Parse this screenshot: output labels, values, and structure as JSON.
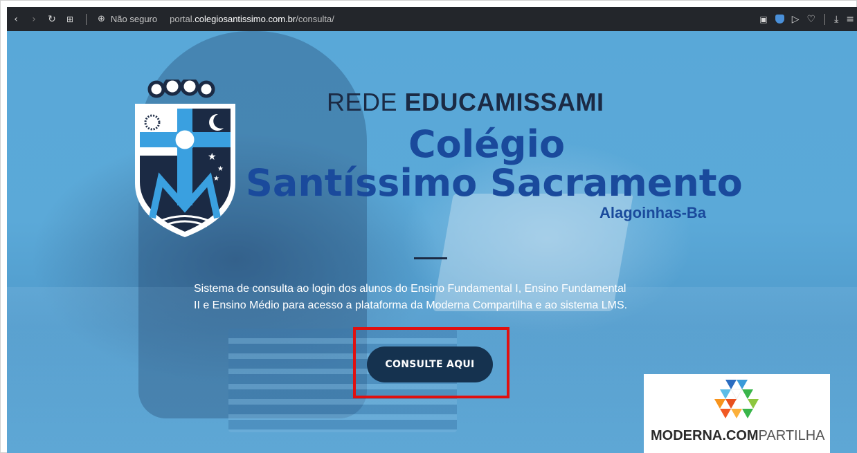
{
  "browser": {
    "security_label": "Não seguro",
    "url_prefix": "portal.",
    "url_domain": "colegiosantissimo.com.br",
    "url_path": "/consulta/"
  },
  "header": {
    "rede_prefix": "REDE ",
    "rede_bold": "EDUCAMISSAMI",
    "school_line1": "Colégio",
    "school_line2": "Santíssimo Sacramento",
    "city": "Alagoinhas-Ba"
  },
  "main": {
    "description_line1": "Sistema de consulta ao login dos alunos do Ensino Fundamental I, Ensino Fundamental",
    "description_line2": "II e Ensino Médio para acesso a plataforma da Moderna Compartilha e ao sistema LMS.",
    "cta_label": "CONSULTE AQUI"
  },
  "partner": {
    "brand_bold": "MODERNA.COM",
    "brand_light": "PARTILHA"
  },
  "colors": {
    "toolbar": "#23262b",
    "hero_blue": "#59a8d8",
    "title_navy": "#1a4a9c",
    "cta_bg": "#15324f",
    "highlight_red": "#e01010"
  }
}
